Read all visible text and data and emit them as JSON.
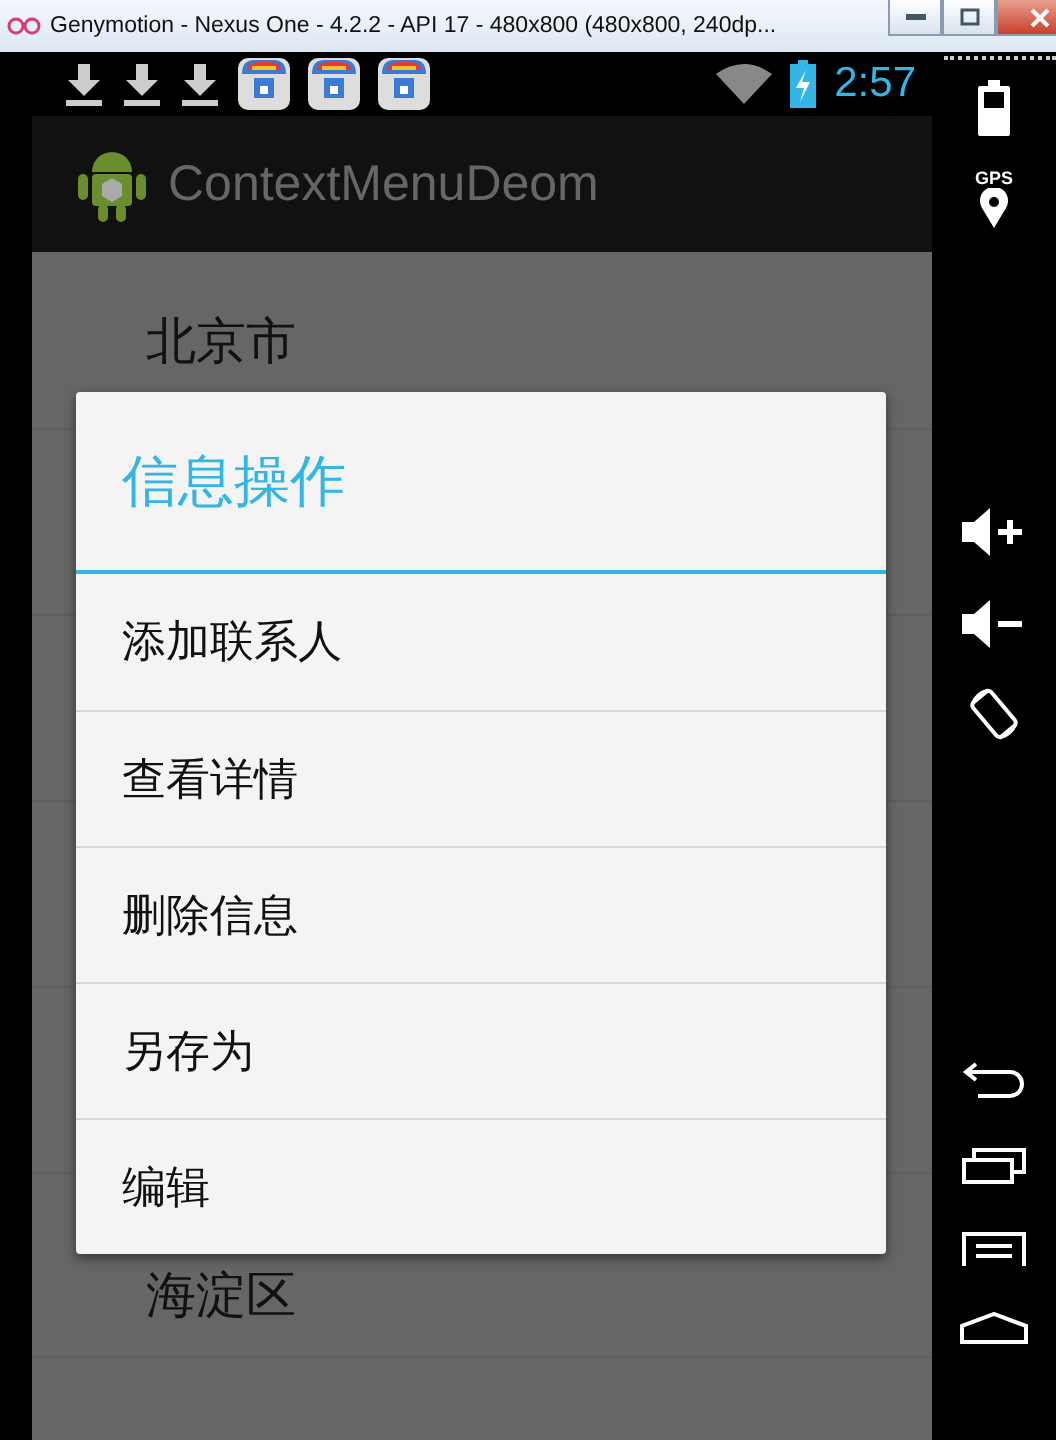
{
  "window": {
    "title": "Genymotion - Nexus One - 4.2.2 - API 17 - 480x800 (480x800, 240dp..."
  },
  "status_bar": {
    "notifications": [
      {
        "kind": "download"
      },
      {
        "kind": "download"
      },
      {
        "kind": "download"
      },
      {
        "kind": "store"
      },
      {
        "kind": "store"
      },
      {
        "kind": "store"
      }
    ],
    "time": "2:57"
  },
  "action_bar": {
    "title": "ContextMenuDeom"
  },
  "list": {
    "rows": [
      {
        "label": "北京市"
      },
      {
        "label": "海淀区"
      }
    ]
  },
  "context_menu": {
    "title": "信息操作",
    "items": [
      "添加联系人",
      "查看详情",
      "删除信息",
      "另存为",
      "编辑"
    ]
  },
  "side_panel": {
    "gps_label": "GPS"
  }
}
